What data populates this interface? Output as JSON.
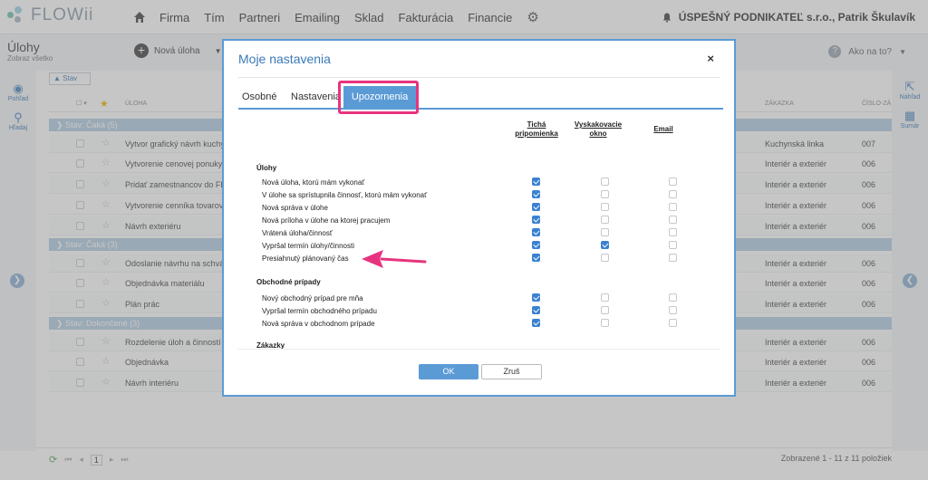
{
  "app": {
    "logo_text": "FLOWii",
    "nav": [
      "Firma",
      "Tím",
      "Partneri",
      "Emailing",
      "Sklad",
      "Fakturácia",
      "Financie"
    ],
    "company": "ÚSPEŠNÝ PODNIKATEĽ s.r.o., Patrik Škulavík"
  },
  "subheader": {
    "title": "Úlohy",
    "subtitle": "Zobraz všetko",
    "new_task": "Nová úloha",
    "help": "Ako na to?"
  },
  "leftbar": {
    "view_label": "Pohľad",
    "search_label": "Hľadaj"
  },
  "rightbar": {
    "preview_label": "Náhľad",
    "summary_label": "Sumár"
  },
  "grid": {
    "filter_chip": "Stav",
    "headers": {
      "task": "ÚLOHA",
      "client": "ZÁKAZKA",
      "number": "ČÍSLO-ZÁ"
    },
    "groups": [
      {
        "label": "Stav: Čaká (5)",
        "rows": [
          {
            "name": "Vytvor grafický návrh kuchyn",
            "client": "Kuchynská linka",
            "number": "007"
          },
          {
            "name": "Vytvorenie cenovej ponuky",
            "client": "Interiér a exteriér",
            "number": "006"
          },
          {
            "name": "Pridať zamestnancov do FLO",
            "client": "Interiér a exteriér",
            "number": "006"
          },
          {
            "name": "Vytvorenie cenníka tovarov a",
            "client": "Interiér a exteriér",
            "number": "006"
          },
          {
            "name": "Návrh exteriéru",
            "client": "Interiér a exteriér",
            "number": "006"
          }
        ]
      },
      {
        "label": "Stav: Čaká (3)",
        "rows": [
          {
            "name": "Odoslanie návrhu na schvále",
            "client": "Interiér a exteriér",
            "number": "006"
          },
          {
            "name": "Objednávka materiálu",
            "client": "Interiér a exteriér",
            "number": "006"
          },
          {
            "name": "Plán prác",
            "client": "Interiér a exteriér",
            "number": "006"
          }
        ]
      },
      {
        "label": "Stav: Dokončené (3)",
        "rows": [
          {
            "name": "Rozdelenie úloh a činností",
            "client": "Interiér a exteriér",
            "number": "006"
          },
          {
            "name": "Objednávka",
            "client": "Interiér a exteriér",
            "number": "006"
          },
          {
            "name": "Návrh interiéru",
            "client": "Interiér a exteriér",
            "number": "006"
          }
        ]
      }
    ]
  },
  "footer": {
    "page": "1",
    "count": "Zobrazené 1 - 11 z 11 položiek"
  },
  "modal": {
    "title": "Moje nastavenia",
    "close": "×",
    "tabs": {
      "personal": "Osobné",
      "settings": "Nastavenia",
      "notifications": "Upozornenia"
    },
    "columns": {
      "quiet": "Tichá pripomienka",
      "popup": "Vyskakovacie okno",
      "email": "Email"
    },
    "sections": {
      "tasks": "Úlohy",
      "deals": "Obchodné prípady",
      "orders": "Zákazky"
    },
    "task_options": [
      {
        "label": "Nová úloha, ktorú mám vykonať",
        "quiet": true,
        "popup": false,
        "email": false
      },
      {
        "label": "V úlohe sa sprístupnila činnosť, ktorú mám vykonať",
        "quiet": true,
        "popup": false,
        "email": false
      },
      {
        "label": "Nová správa v úlohe",
        "quiet": true,
        "popup": false,
        "email": false
      },
      {
        "label": "Nová príloha v úlohe na ktorej pracujem",
        "quiet": true,
        "popup": false,
        "email": false
      },
      {
        "label": "Vrátená úloha/činnosť",
        "quiet": true,
        "popup": false,
        "email": false
      },
      {
        "label": "Vypršal termín úlohy/činnosti",
        "quiet": true,
        "popup": true,
        "email": false
      },
      {
        "label": "Presiahnutý plánovaný čas",
        "quiet": true,
        "popup": false,
        "email": false
      }
    ],
    "deal_options": [
      {
        "label": "Nový obchodný prípad pre mňa",
        "quiet": true,
        "popup": false,
        "email": false
      },
      {
        "label": "Vypršal termín obchodného prípadu",
        "quiet": true,
        "popup": false,
        "email": false
      },
      {
        "label": "Nová správa v obchodnom prípade",
        "quiet": true,
        "popup": false,
        "email": false
      }
    ],
    "ok_label": "OK",
    "cancel_label": "Zruš"
  },
  "colors": {
    "accent": "#5b9bd5",
    "highlight": "#e8347e",
    "group_row": "#b3cde3"
  }
}
